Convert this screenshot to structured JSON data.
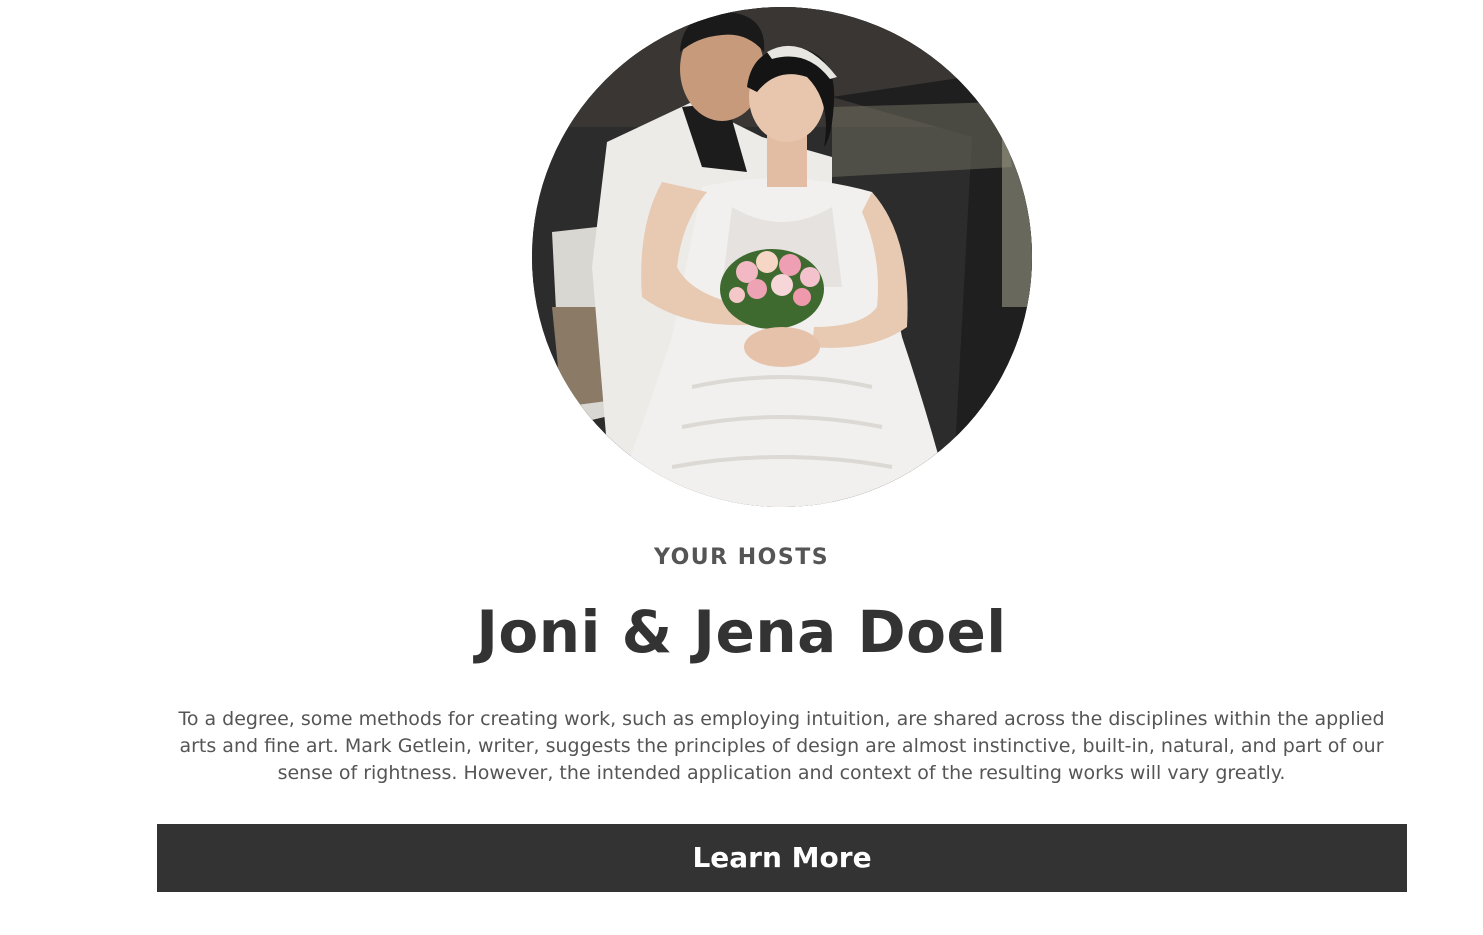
{
  "hosts": {
    "photo_alt": "Bride and groom embracing, bride holding a pink rose bouquet",
    "eyebrow": "YOUR HOSTS",
    "names": "Joni & Jena Doel",
    "bio": "To a degree, some methods for creating work, such as employing intuition, are shared across the disciplines within the applied arts and fine art. Mark Getlein, writer, suggests the principles of design are almost instinctive, built-in, natural, and part of our sense of rightness. However, the intended application and context of the resulting works will vary greatly.",
    "button_label": "Learn More"
  },
  "colors": {
    "button_bg": "#333333",
    "heading": "#333333",
    "body_text": "#555555"
  }
}
